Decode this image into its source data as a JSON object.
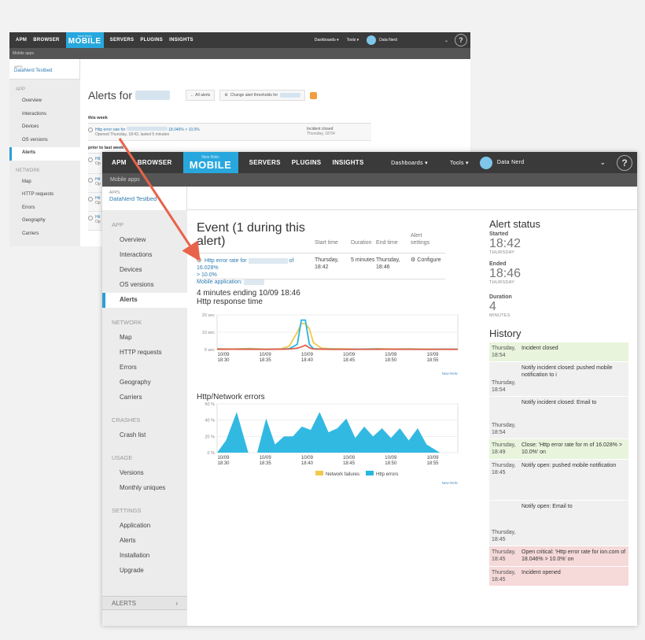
{
  "nav": {
    "apm": "APM",
    "browser": "BROWSER",
    "mobile_small": "New Relic",
    "mobile": "MOBILE",
    "servers": "SERVERS",
    "plugins": "PLUGINS",
    "insights": "INSIGHTS",
    "dashboards": "Dashboards ▾",
    "tools": "Tools ▾",
    "user": "Data Nerd",
    "help": "?"
  },
  "subbar": "Mobile apps",
  "app": {
    "label": "APPS",
    "name": "DataNerd Testbed"
  },
  "sidebar": {
    "app_section": "APP",
    "app_items": [
      "Overview",
      "Interactions",
      "Devices",
      "OS versions",
      "Alerts"
    ],
    "network_section": "NETWORK",
    "network_items": [
      "Map",
      "HTTP requests",
      "Errors",
      "Geography",
      "Carriers"
    ],
    "crashes_section": "CRASHES",
    "crashes_items": [
      "Crash list"
    ],
    "usage_section": "USAGE",
    "usage_items": [
      "Versions",
      "Monthly uniques"
    ],
    "settings_section": "SETTINGS",
    "settings_items": [
      "Application",
      "Alerts",
      "Installation",
      "Upgrade"
    ],
    "footer": "ALERTS",
    "footer_chevron": "›"
  },
  "bg": {
    "title": "Alerts for",
    "all_alerts": "← All alerts",
    "change_thresholds": "Change alert thresholds for",
    "this_week": "this week",
    "prior": "prior to last week",
    "row1": {
      "text": "Http error rate for",
      "value": "18.046% > 10.0%",
      "sub": "Opened Thursday, 18:42, lasted 5 minutes",
      "status": "Incident closed",
      "time": "Thursday, 18:54"
    },
    "row_prefix": [
      "Htt",
      "Htt",
      "Htt",
      "Htt"
    ],
    "row_sub_prefix": [
      "Op",
      "Op",
      "Op",
      "Op"
    ]
  },
  "event": {
    "title": "Event (1 during this alert)",
    "col_start": "Start time",
    "col_duration": "Duration",
    "col_end": "End time",
    "col_settings": "Alert settings",
    "link_text": "Http error rate for",
    "link_value": "of 16.028%",
    "link_value2": "> 10.0%",
    "mobile_app": "Mobile application:",
    "start": "Thursday, 18:42",
    "duration": "5 minutes",
    "end": "Thursday, 18:46",
    "configure": "Configure"
  },
  "range_text": "4 minutes ending 10/09 18:46",
  "chart_data": [
    {
      "type": "line",
      "title": "Http response time",
      "y_ticks": [
        "20 sec",
        "10 sec",
        "0 sec"
      ],
      "ylim": [
        0,
        20
      ],
      "x_ticks": [
        "10/09 18:30",
        "10/09 18:35",
        "10/09 18:40",
        "10/09 18:45",
        "10/09 18:50",
        "10/09 18:55"
      ],
      "x": [
        0,
        2,
        4,
        6,
        8,
        9,
        10,
        10.5,
        11,
        11.5,
        12,
        13,
        14,
        16,
        18,
        20,
        22,
        24,
        26,
        28,
        30
      ],
      "series": [
        {
          "color": "#f2c84b",
          "values": [
            0.5,
            0.3,
            0.6,
            0.2,
            0.4,
            2,
            10,
            15,
            15,
            12,
            4,
            0.8,
            0.5,
            0.4,
            0.2,
            0.5,
            0.3,
            0.4,
            0.2,
            0.3,
            0.2
          ]
        },
        {
          "color": "#27b5e0",
          "values": [
            0.2,
            0.2,
            0.3,
            0.1,
            0.2,
            0.5,
            3,
            17,
            17,
            3,
            0.5,
            0.3,
            0.2,
            0.1,
            0.2,
            0.3,
            0.1,
            0.2,
            0.1,
            0.2,
            0.1
          ]
        },
        {
          "color": "#e35d4a",
          "values": [
            0.1,
            0.2,
            0.1,
            0.1,
            0.2,
            0.3,
            0.8,
            1.5,
            2.5,
            1,
            0.3,
            0.2,
            0.1,
            0.1,
            0.1,
            0.1,
            0.2,
            0.1,
            0.1,
            0.1,
            0.1
          ]
        }
      ],
      "footnote": "New Relic"
    },
    {
      "type": "area",
      "title": "Http/Network errors",
      "y_ticks": [
        "60 %",
        "40 %",
        "20 %",
        "0 %"
      ],
      "ylim": [
        0,
        60
      ],
      "x_ticks": [
        "10/09 18:30",
        "10/09 18:35",
        "10/09 18:40",
        "10/09 18:45",
        "10/09 18:50",
        "10/09 18:55"
      ],
      "x": [
        0,
        1,
        2.2,
        3.5,
        4.5,
        5.5,
        6.5,
        7.5,
        8.5,
        9.5,
        10.5,
        11.5,
        12.5,
        13.5,
        14.5,
        15.5,
        16.5,
        17.5,
        18.5,
        19.5,
        20.5,
        21.5,
        22.5,
        23.5,
        25,
        26,
        27
      ],
      "series": [
        {
          "name": "Network failures",
          "color": "#f2c84b",
          "values": [
            0,
            0,
            0,
            0,
            0,
            0,
            0,
            0,
            0,
            0,
            0,
            0,
            0,
            0,
            0,
            0,
            0,
            0,
            0,
            0,
            0,
            0,
            0,
            0,
            0,
            0,
            0
          ]
        },
        {
          "name": "Http errors",
          "color": "#27b5e0",
          "values": [
            0,
            15,
            50,
            0,
            0,
            42,
            10,
            20,
            20,
            32,
            28,
            50,
            25,
            30,
            42,
            18,
            32,
            20,
            30,
            18,
            30,
            15,
            30,
            10,
            0,
            0,
            0
          ]
        }
      ],
      "footnote": "New Relic"
    }
  ],
  "alert_status": {
    "title": "Alert status",
    "started_label": "Started",
    "started": "18:42",
    "started_sub": "THURSDAY",
    "ended_label": "Ended",
    "ended": "18:46",
    "ended_sub": "THURSDAY",
    "duration_label": "Duration",
    "duration": "4",
    "duration_sub": "MINUTES"
  },
  "history": {
    "title": "History",
    "rows": [
      {
        "time": "Thursday, 18:54",
        "text": "Incident closed",
        "kind": "green"
      },
      {
        "time": "Thursday, 18:54",
        "text": "Notify incident closed: pushed mobile notification to i",
        "kind": "gray"
      },
      {
        "time": "Thursday, 18:54",
        "text": "Notify incident closed: Email to",
        "kind": "gray"
      },
      {
        "time": "Thursday, 18:49",
        "text": "Close: 'Http error rate for m of 16.028% > 10.0%' on",
        "kind": "green"
      },
      {
        "time": "Thursday, 18:45",
        "text": "Notify open: pushed mobile notification",
        "kind": "gray"
      },
      {
        "time": "Thursday, 18:45",
        "text": "Notify open: Email to",
        "kind": "gray"
      },
      {
        "time": "Thursday, 18:45",
        "text": "Open critical: 'Http error rate for ion.com of 18.046% > 10.0%' on",
        "kind": "red"
      },
      {
        "time": "Thursday, 18:45",
        "text": "Incident opened",
        "kind": "red"
      }
    ]
  },
  "colors": {
    "nav_bg": "#3a3a3a",
    "mobile_accent": "#27a7dd",
    "link": "#2d7ab0",
    "arrow": "#e8634a"
  }
}
